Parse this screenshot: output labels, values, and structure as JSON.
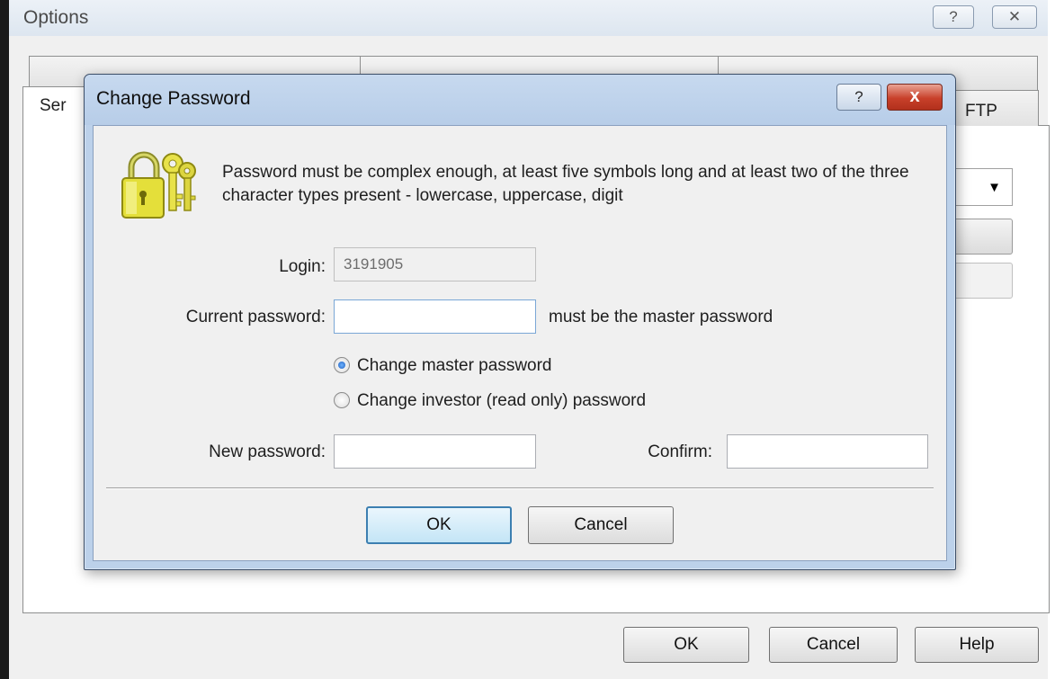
{
  "options_window": {
    "title": "Options",
    "help_glyph": "?",
    "close_glyph": "✕",
    "tabs_back": [
      "",
      "",
      ""
    ],
    "tab_front_label": "Ser",
    "tab_ftp_label": "FTP",
    "buttons": {
      "ok": "OK",
      "cancel": "Cancel",
      "help": "Help"
    }
  },
  "dialog": {
    "title": "Change Password",
    "help_glyph": "?",
    "close_glyph": "x",
    "info_text": "Password must be complex enough, at least five symbols long and at least two of the three character types present - lowercase, uppercase, digit",
    "icon": "lock-keys-icon",
    "login": {
      "label": "Login:",
      "value": "3191905"
    },
    "current_password": {
      "label": "Current password:",
      "value": "",
      "hint": "must be the master password"
    },
    "radios": [
      {
        "label": "Change master password",
        "checked": true
      },
      {
        "label": "Change investor (read only) password",
        "checked": false
      }
    ],
    "new_password": {
      "label": "New password:",
      "value": ""
    },
    "confirm": {
      "label": "Confirm:",
      "value": ""
    },
    "buttons": {
      "ok": "OK",
      "cancel": "Cancel"
    }
  },
  "colors": {
    "dialog_frame": "#bcd1ea",
    "close_button": "#c8402a",
    "default_button_border": "#3c7fb1"
  }
}
